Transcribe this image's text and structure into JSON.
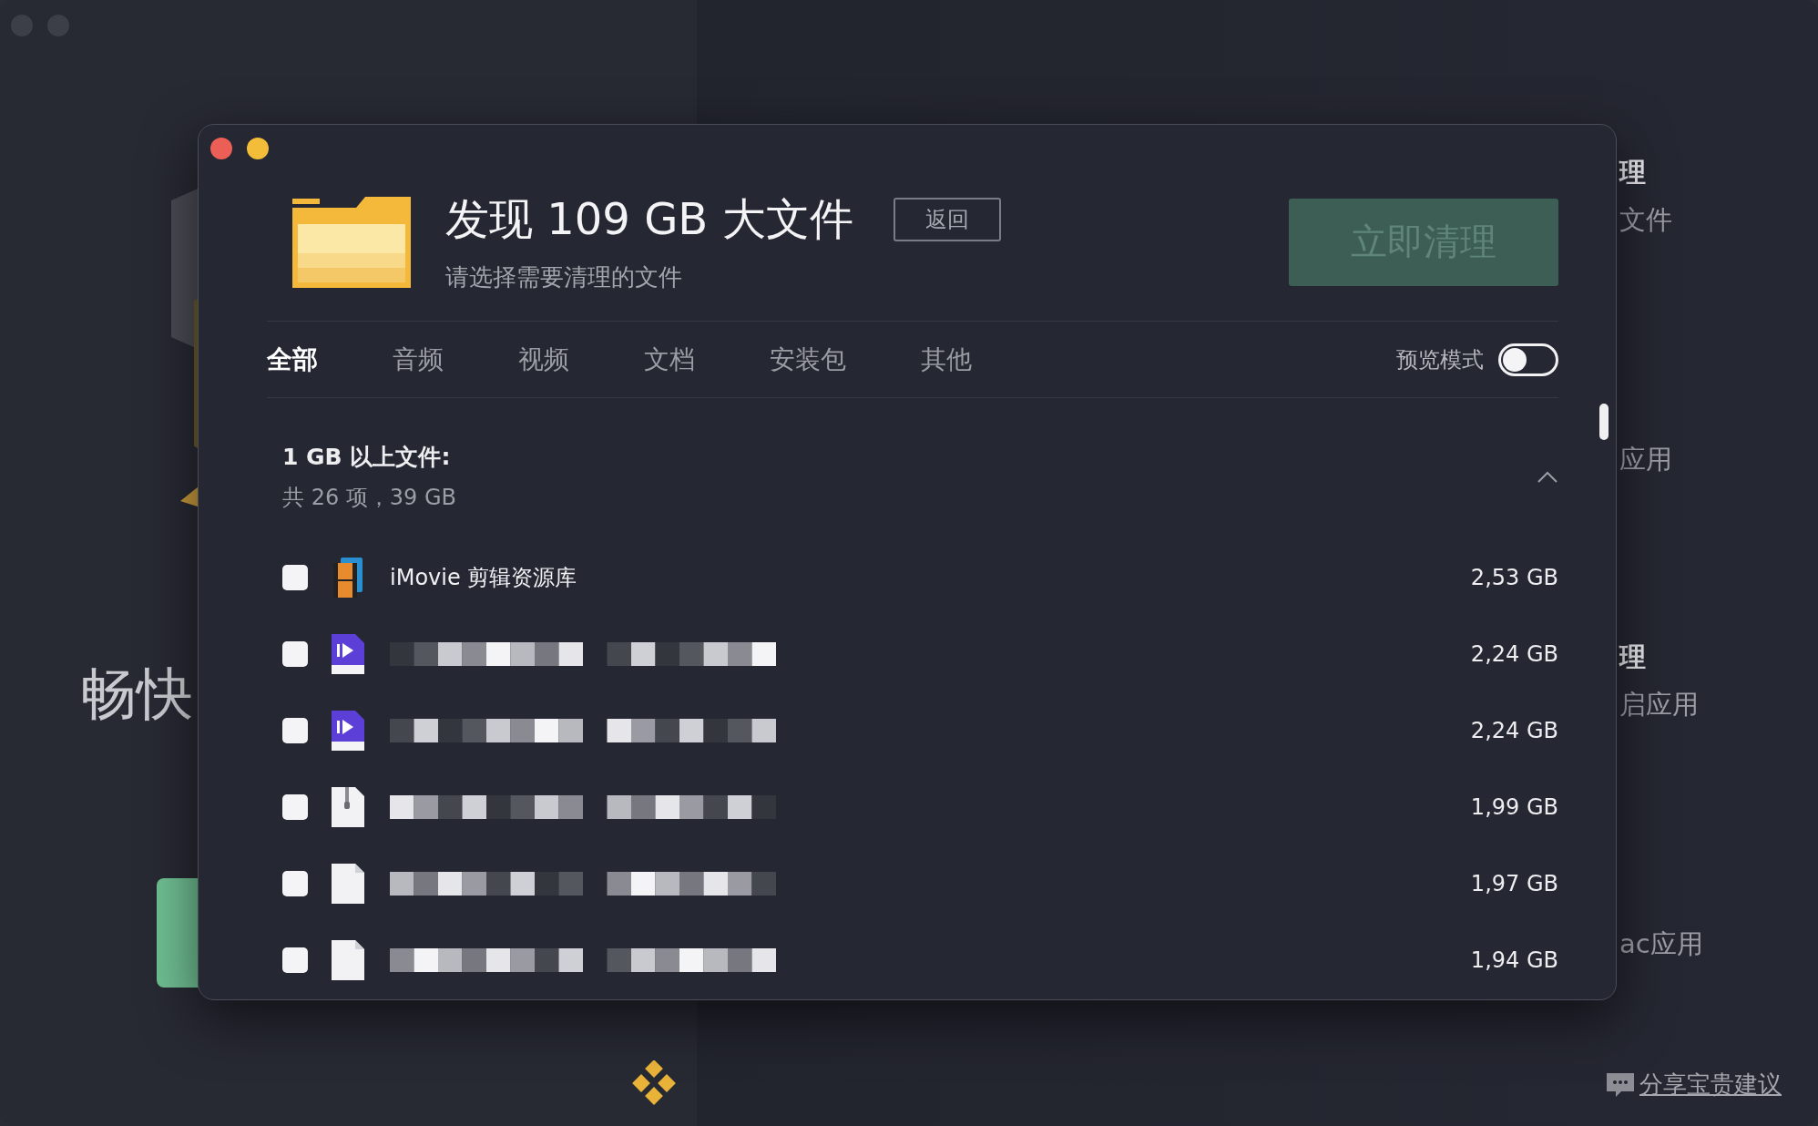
{
  "background": {
    "left_heading": "畅快",
    "right_texts": [
      {
        "text": "理",
        "kind": "heading"
      },
      {
        "text": "文件",
        "kind": "caption"
      },
      {
        "text": "应用",
        "kind": "caption"
      },
      {
        "text": "理",
        "kind": "heading"
      },
      {
        "text": "启应用",
        "kind": "caption"
      },
      {
        "text": "ac应用",
        "kind": "caption"
      }
    ],
    "feedback_link": "分享宝贵建议"
  },
  "dialog": {
    "title": "发现 109 GB 大文件",
    "back_button": "返回",
    "subtitle": "请选择需要清理的文件",
    "clean_button": {
      "label": "立即清理",
      "disabled": true
    },
    "tabs": [
      {
        "label": "全部",
        "selected": true
      },
      {
        "label": "音频",
        "selected": false
      },
      {
        "label": "视频",
        "selected": false
      },
      {
        "label": "文档",
        "selected": false
      },
      {
        "label": "安装包",
        "selected": false
      },
      {
        "label": "其他",
        "selected": false
      }
    ],
    "preview_mode": {
      "label": "预览模式",
      "on": false
    },
    "section": {
      "title": "1 GB 以上文件:",
      "summary": "共 26 项，39 GB",
      "expanded": true
    },
    "files": [
      {
        "kind": "library",
        "name": "iMovie 剪辑资源库",
        "size": "2,53 GB",
        "checked": false
      },
      {
        "kind": "video",
        "size": "2,24 GB",
        "checked": false
      },
      {
        "kind": "video",
        "size": "2,24 GB",
        "checked": false
      },
      {
        "kind": "archive",
        "size": "1,99 GB",
        "checked": false
      },
      {
        "kind": "document",
        "size": "1,97 GB",
        "checked": false
      },
      {
        "kind": "document",
        "size": "1,94 GB",
        "checked": false
      }
    ]
  }
}
